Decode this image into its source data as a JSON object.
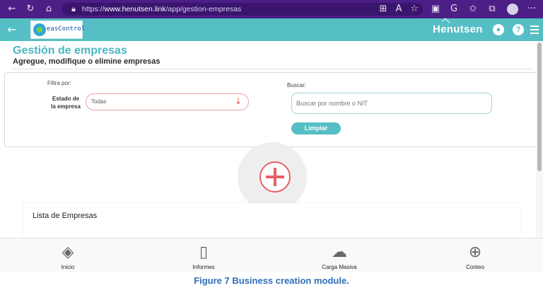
{
  "browser": {
    "url_prefix": "https://",
    "url_host": "www.henutsen.link",
    "url_path": "/app/gestion-empresas"
  },
  "app": {
    "logo_text": "easControl",
    "brand": "Henutsen"
  },
  "page": {
    "title": "Gestión de empresas",
    "subtitle": "Agregue, modifique o elimine empresas"
  },
  "filters": {
    "filter_label": "Filtra por:",
    "estado_label": "Estado de la empresa",
    "estado_value": "Todas",
    "search_label": "Buscar:",
    "search_placeholder": "Buscar por nombre o NIT",
    "clear_button": "Limpiar"
  },
  "list": {
    "title": "Lista de Empresas"
  },
  "bottom_nav": [
    {
      "label": "Inicio"
    },
    {
      "label": "Informes"
    },
    {
      "label": "Carga Masiva"
    },
    {
      "label": "Conteo"
    }
  ],
  "caption": "Figure 7 Business creation module.",
  "colors": {
    "browser": "#4b1f86",
    "header": "#55bfc5",
    "accent_red": "#e85f66",
    "caption": "#2f6fb8"
  }
}
